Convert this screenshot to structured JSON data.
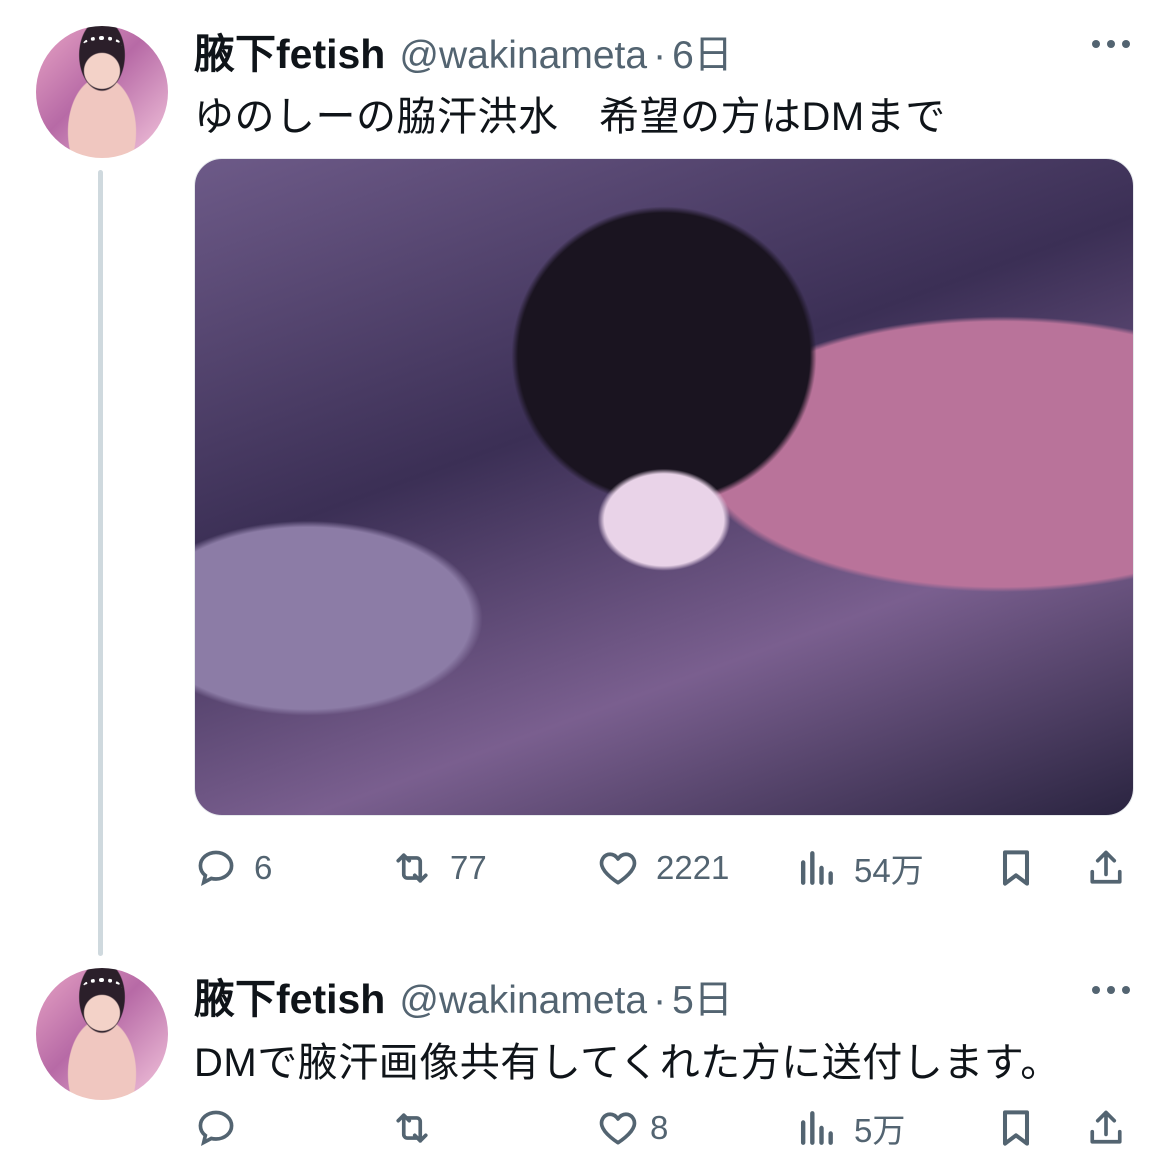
{
  "tweets": [
    {
      "author_name": "腋下fetish",
      "handle": "@wakinameta",
      "separator": "·",
      "time": "6日",
      "text": "ゆのしーの脇汗洪水　希望の方はDMまで",
      "has_media": true,
      "stats": {
        "replies": "6",
        "retweets": "77",
        "likes": "2221",
        "views": "54万"
      }
    },
    {
      "author_name": "腋下fetish",
      "handle": "@wakinameta",
      "separator": "·",
      "time": "5日",
      "text": "DMで腋汗画像共有してくれた方に送付します。",
      "has_media": false,
      "stats": {
        "replies": "",
        "retweets": "",
        "likes": "8",
        "views": "5万"
      }
    }
  ],
  "icons": {
    "reply": "comment-bubble-icon",
    "retweet": "retweet-arrows-icon",
    "like": "heart-icon",
    "views": "bar-chart-icon",
    "bookmark": "bookmark-icon",
    "share": "share-upload-icon",
    "more": "more-dots-icon"
  },
  "colors": {
    "text": "#0f1419",
    "secondary": "#536471",
    "thread_line": "#cfd9de",
    "background": "#ffffff"
  }
}
